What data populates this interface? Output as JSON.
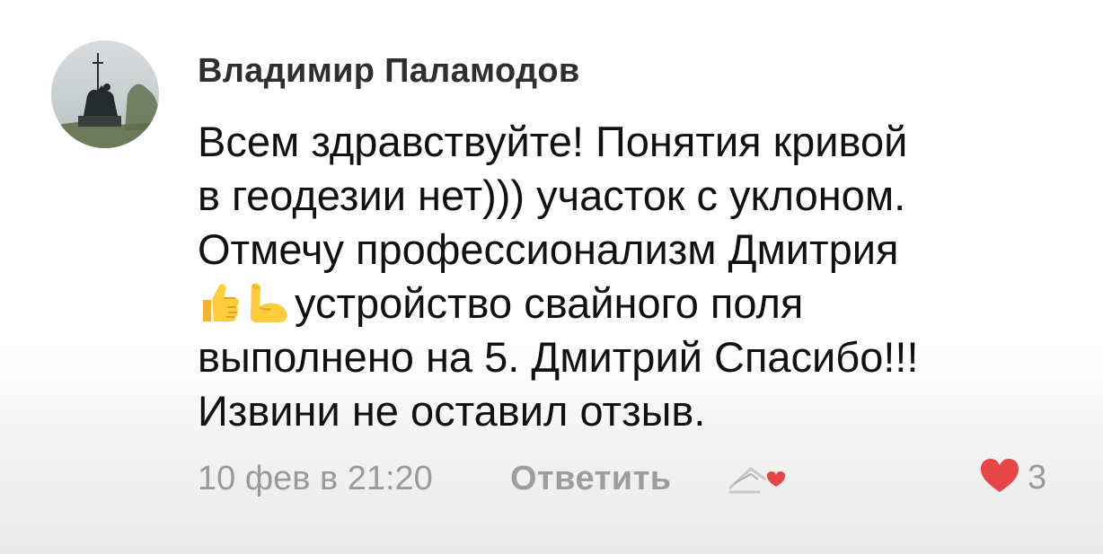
{
  "comment": {
    "author": "Владимир Паламодов",
    "avatar_icon": "monument-avatar",
    "text_lines": [
      {
        "pre_emojis": [],
        "text": "Всем здравствуйте! Понятия кривой"
      },
      {
        "pre_emojis": [],
        "text": "в геодезии нет))) участок с уклоном."
      },
      {
        "pre_emojis": [],
        "text": "Отмечу профессионализм Дмитрия"
      },
      {
        "pre_emojis": [
          "thumbs-up-icon",
          "flexed-biceps-icon"
        ],
        "text": "устройство свайного поля"
      },
      {
        "pre_emojis": [],
        "text": "выполнено на 5. Дмитрий Спасибо!!!"
      },
      {
        "pre_emojis": [],
        "text": "Извини не оставил отзыв."
      }
    ],
    "timestamp": "10 фев в 21:20",
    "reply_label": "Ответить",
    "badge_icon": "community-heart-logo-icon",
    "likes": "3",
    "like_color": "#e64646"
  }
}
